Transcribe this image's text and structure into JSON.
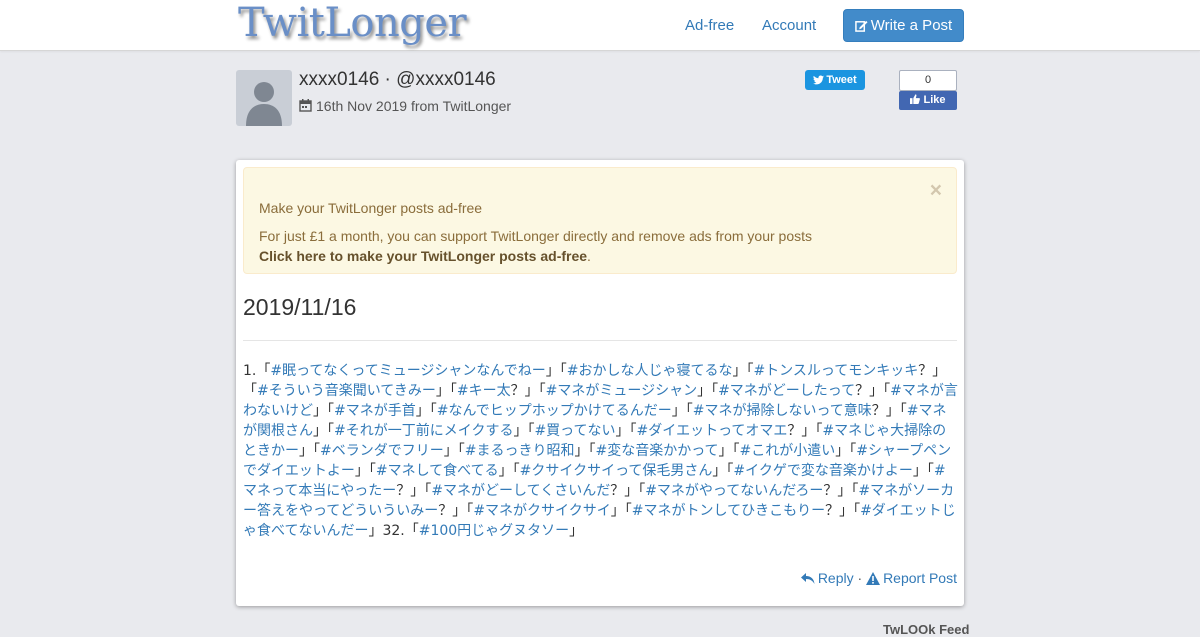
{
  "header": {
    "logo": "TwitLonger",
    "nav": {
      "adfree": "Ad-free",
      "account": "Account"
    },
    "write_button": "Write a Post"
  },
  "post_meta": {
    "author": "xxxx0146 · @xxxx0146",
    "date": "16th Nov 2019 from TwitLonger"
  },
  "share": {
    "tweet": "Tweet",
    "fb_count": "0",
    "fb_like": "Like"
  },
  "alert": {
    "title": "Make your TwitLonger posts ad-free",
    "text": "For just £1 a month, you can support TwitLonger directly and remove ads from your posts",
    "link": "Click here to make your TwitLonger posts ad-free",
    "link_suffix": ".",
    "close": "×"
  },
  "post": {
    "title": "2019/11/16",
    "segments": [
      {
        "t": "1.「",
        "tag": false
      },
      {
        "t": "#眠ってなくってミュージシャンなんでねー",
        "tag": true
      },
      {
        "t": "」「",
        "tag": false
      },
      {
        "t": "#おかしな人じゃ寝てるな",
        "tag": true
      },
      {
        "t": "」「",
        "tag": false
      },
      {
        "t": "#トンスルってモンキッキ",
        "tag": true
      },
      {
        "t": "？」「",
        "tag": false
      },
      {
        "t": "#そういう音楽聞いてきみー",
        "tag": true
      },
      {
        "t": "」「",
        "tag": false
      },
      {
        "t": "#キー太",
        "tag": true
      },
      {
        "t": "？」「",
        "tag": false
      },
      {
        "t": "#マネがミュージシャン",
        "tag": true
      },
      {
        "t": "」「",
        "tag": false
      },
      {
        "t": "#マネがどーしたって",
        "tag": true
      },
      {
        "t": "？」「",
        "tag": false
      },
      {
        "t": "#マネが言わないけど",
        "tag": true
      },
      {
        "t": "」「",
        "tag": false
      },
      {
        "t": "#マネが手首",
        "tag": true
      },
      {
        "t": "」「",
        "tag": false
      },
      {
        "t": "#なんでヒップホップかけてるんだー",
        "tag": true
      },
      {
        "t": "」「",
        "tag": false
      },
      {
        "t": "#マネが掃除しないって意味",
        "tag": true
      },
      {
        "t": "？」「",
        "tag": false
      },
      {
        "t": "#マネが関根さん",
        "tag": true
      },
      {
        "t": "」「",
        "tag": false
      },
      {
        "t": "#それが一丁前にメイクする",
        "tag": true
      },
      {
        "t": "」「",
        "tag": false
      },
      {
        "t": "#買ってない",
        "tag": true
      },
      {
        "t": "」「",
        "tag": false
      },
      {
        "t": "#ダイエットってオマエ",
        "tag": true
      },
      {
        "t": "？」「",
        "tag": false
      },
      {
        "t": "#マネじゃ大掃除のときかー",
        "tag": true
      },
      {
        "t": "」「",
        "tag": false
      },
      {
        "t": "#ベランダでフリー",
        "tag": true
      },
      {
        "t": "」「",
        "tag": false
      },
      {
        "t": "#まるっきり昭和",
        "tag": true
      },
      {
        "t": "」「",
        "tag": false
      },
      {
        "t": "#変な音楽かかって",
        "tag": true
      },
      {
        "t": "」「",
        "tag": false
      },
      {
        "t": "#これが小遣い",
        "tag": true
      },
      {
        "t": "」「",
        "tag": false
      },
      {
        "t": "#シャープペンでダイエットよー",
        "tag": true
      },
      {
        "t": "」「",
        "tag": false
      },
      {
        "t": "#マネして食べてる",
        "tag": true
      },
      {
        "t": "」「",
        "tag": false
      },
      {
        "t": "#クサイクサイって保毛男さん",
        "tag": true
      },
      {
        "t": "」「",
        "tag": false
      },
      {
        "t": "#イクゲで変な音楽かけよー",
        "tag": true
      },
      {
        "t": "」「",
        "tag": false
      },
      {
        "t": "#マネって本当にやったー",
        "tag": true
      },
      {
        "t": "？」「",
        "tag": false
      },
      {
        "t": "#マネがどーしてくさいんだ",
        "tag": true
      },
      {
        "t": "？」「",
        "tag": false
      },
      {
        "t": "#マネがやってないんだろー",
        "tag": true
      },
      {
        "t": "？」「",
        "tag": false
      },
      {
        "t": "#マネがソーカー答えをやってどういういみー",
        "tag": true
      },
      {
        "t": "？」「",
        "tag": false
      },
      {
        "t": "#マネがクサイクサイ",
        "tag": true
      },
      {
        "t": "」「",
        "tag": false
      },
      {
        "t": "#マネがトンしてひきこもりー",
        "tag": true
      },
      {
        "t": "？」「",
        "tag": false
      },
      {
        "t": "#ダイエットじゃ食べてないんだー",
        "tag": true
      },
      {
        "t": "」32.「",
        "tag": false
      },
      {
        "t": "#100円じゃグヌタソー",
        "tag": true
      },
      {
        "t": "」",
        "tag": false
      }
    ]
  },
  "actions": {
    "reply": "Reply",
    "separator": "·",
    "report": "Report Post"
  },
  "footer": {
    "feed": "TwLOOk Feed"
  },
  "colors": {
    "link": "#337ab7",
    "button": "#428bca",
    "alert_bg": "#fcf8e3",
    "background": "#e9eaee"
  }
}
